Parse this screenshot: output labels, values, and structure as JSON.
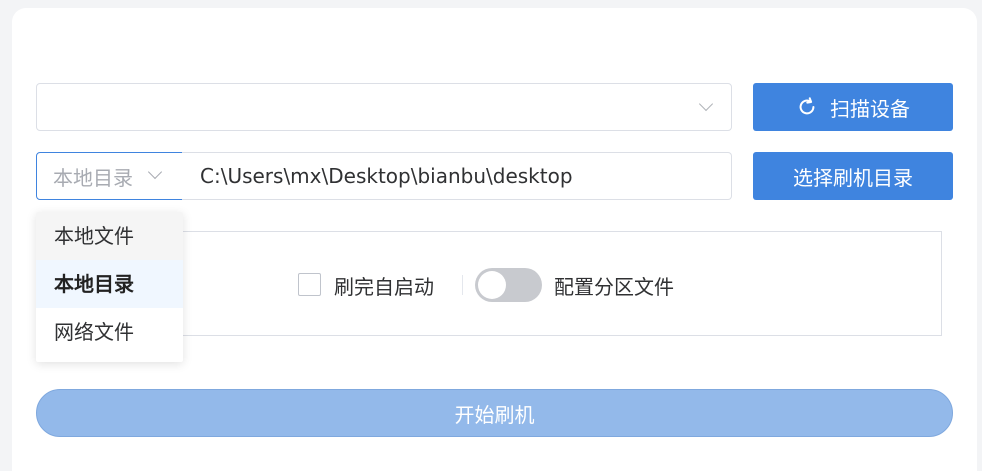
{
  "device": {
    "value": "",
    "icon": "chevron-down-icon"
  },
  "scan": {
    "label": "扫描设备",
    "icon": "refresh-icon"
  },
  "source": {
    "mode_selected": "本地目录",
    "path_value": "C:\\Users\\mx\\Desktop\\bianbu\\desktop",
    "options": [
      "本地文件",
      "本地目录",
      "网络文件"
    ],
    "selected_index": 1
  },
  "select_dir": {
    "label": "选择刷机目录"
  },
  "options": {
    "auto_start_label": "刷完自启动",
    "auto_start_checked": false,
    "partition_label": "配置分区文件",
    "partition_enabled": false
  },
  "start": {
    "label": "开始刷机"
  },
  "colors": {
    "primary": "#3f84df",
    "primary_disabled": "#93b9ea",
    "border": "#dcdfe6"
  }
}
